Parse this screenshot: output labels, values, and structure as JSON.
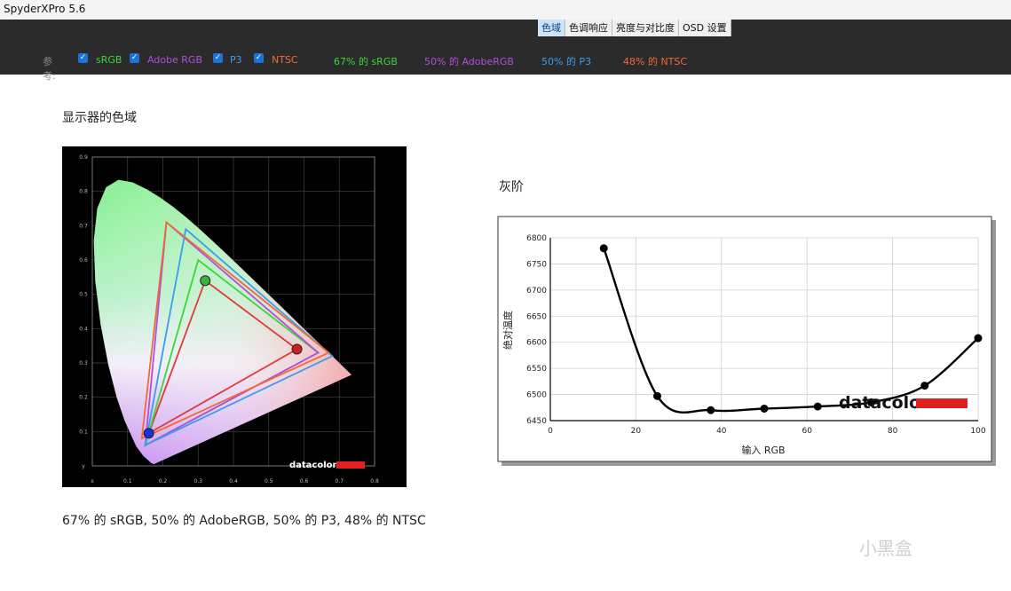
{
  "app_title": "SpyderXPro 5.6",
  "tabs": [
    "色域",
    "色调响应",
    "亮度与对比度",
    "OSD 设置"
  ],
  "active_tab": 0,
  "reference": {
    "label": "参考:",
    "items": [
      {
        "label": "sRGB",
        "color": "#3bd63b",
        "checked": true
      },
      {
        "label": "Adobe RGB",
        "color": "#b04fe0",
        "checked": true
      },
      {
        "label": "P3",
        "color": "#3a9df0",
        "checked": true
      },
      {
        "label": "NTSC",
        "color": "#ee6a3a",
        "checked": true
      }
    ],
    "coverage": [
      {
        "text": "67% 的 sRGB",
        "color": "#3bd63b"
      },
      {
        "text": "50% 的 AdobeRGB",
        "color": "#b04fe0"
      },
      {
        "text": "50% 的 P3",
        "color": "#3a9df0"
      },
      {
        "text": "48% 的 NTSC",
        "color": "#ee6a3a"
      }
    ]
  },
  "gamut": {
    "title": "显示器的色域",
    "caption": "67% 的 sRGB, 50% 的 AdobeRGB, 50% 的 P3, 48% 的 NTSC",
    "brand": "datacolor",
    "x_ticks": [
      "x",
      "0.1",
      "0.2",
      "0.3",
      "0.4",
      "0.5",
      "0.6",
      "0.7",
      "0.8"
    ],
    "y_ticks": [
      "y",
      "0.1",
      "0.2",
      "0.3",
      "0.4",
      "0.5",
      "0.6",
      "0.7",
      "0.8",
      "0.9"
    ],
    "triangles": [
      {
        "name": "display",
        "color": "#e03a3a",
        "points": [
          [
            0.58,
            0.34
          ],
          [
            0.32,
            0.54
          ],
          [
            0.16,
            0.095
          ]
        ]
      },
      {
        "name": "sRGB",
        "color": "#3bd63b",
        "points": [
          [
            0.64,
            0.33
          ],
          [
            0.3,
            0.6
          ],
          [
            0.15,
            0.06
          ]
        ]
      },
      {
        "name": "Adobe RGB",
        "color": "#b04fe0",
        "points": [
          [
            0.64,
            0.33
          ],
          [
            0.21,
            0.71
          ],
          [
            0.15,
            0.06
          ]
        ]
      },
      {
        "name": "P3",
        "color": "#3a9df0",
        "points": [
          [
            0.68,
            0.32
          ],
          [
            0.265,
            0.69
          ],
          [
            0.15,
            0.06
          ]
        ]
      },
      {
        "name": "NTSC",
        "color": "#ee6a3a",
        "points": [
          [
            0.67,
            0.33
          ],
          [
            0.21,
            0.71
          ],
          [
            0.14,
            0.08
          ]
        ]
      }
    ],
    "primaries": [
      {
        "name": "red",
        "color": "#cc2020",
        "point": [
          0.58,
          0.34
        ]
      },
      {
        "name": "green",
        "color": "#3ab43a",
        "point": [
          0.32,
          0.54
        ]
      },
      {
        "name": "blue",
        "color": "#1a2fd8",
        "point": [
          0.16,
          0.095
        ]
      }
    ]
  },
  "grayscale": {
    "title": "灰阶",
    "brand": "datacolor",
    "chart_data": {
      "type": "line",
      "xlabel": "输入 RGB",
      "ylabel": "绝对温度",
      "xlim": [
        0,
        100
      ],
      "ylim": [
        6450,
        6800
      ],
      "x_ticks": [
        "0",
        "20",
        "40",
        "60",
        "80",
        "100"
      ],
      "y_ticks": [
        "6450",
        "6500",
        "6550",
        "6600",
        "6650",
        "6700",
        "6750",
        "6800"
      ],
      "grid": true,
      "x": [
        12.5,
        25,
        37.5,
        50,
        62.5,
        75,
        87.5,
        100
      ],
      "y": [
        6780,
        6497,
        6470,
        6473,
        6477,
        6485,
        6517,
        6608
      ]
    }
  },
  "watermark": "小黑盒"
}
